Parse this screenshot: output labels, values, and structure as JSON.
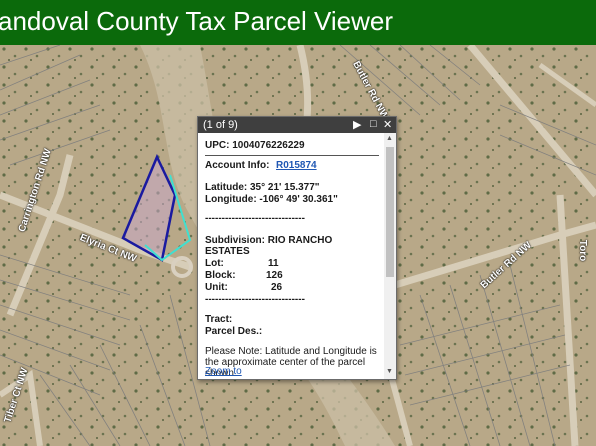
{
  "app": {
    "title": "andoval County Tax Parcel Viewer"
  },
  "map": {
    "roads": [
      "Butler Rd NW",
      "Butler Rd NW",
      "Elyria Ct NW",
      "Carrington Rd NW",
      "Tiber Ct NW",
      "Toro"
    ]
  },
  "popup": {
    "count": "(1 of 9)",
    "upc": "UPC: 1004076226229",
    "account_label": "Account Info:",
    "account_value": "R015874",
    "latitude": "Latitude: 35° 21' 15.377\"",
    "longitude": "Longitude: -106° 49' 30.361\"",
    "divider": "------------------------------",
    "subdivision_line1": "Subdivision: RIO RANCHO",
    "subdivision_line2": "ESTATES",
    "lot_label": "Lot:",
    "lot_value": "11",
    "block_label": "Block:",
    "block_value": "126",
    "unit_label": "Unit:",
    "unit_value": "26",
    "tract_label": "Tract:",
    "parcel_label": "Parcel Des.:",
    "note_line1": "Please Note: Latitude and Longitude is",
    "note_line2": "the approximate center of the parcel",
    "note_line3": "shown.",
    "zoom_label": "Zoom to",
    "icons": [
      "play-icon",
      "maximize-icon",
      "close-icon"
    ]
  },
  "colors": {
    "header": "#0b6a0b",
    "parcel_outline": "#1a1aa0",
    "parcel_highlight": "#40e0d0",
    "link": "#1f57b3"
  }
}
